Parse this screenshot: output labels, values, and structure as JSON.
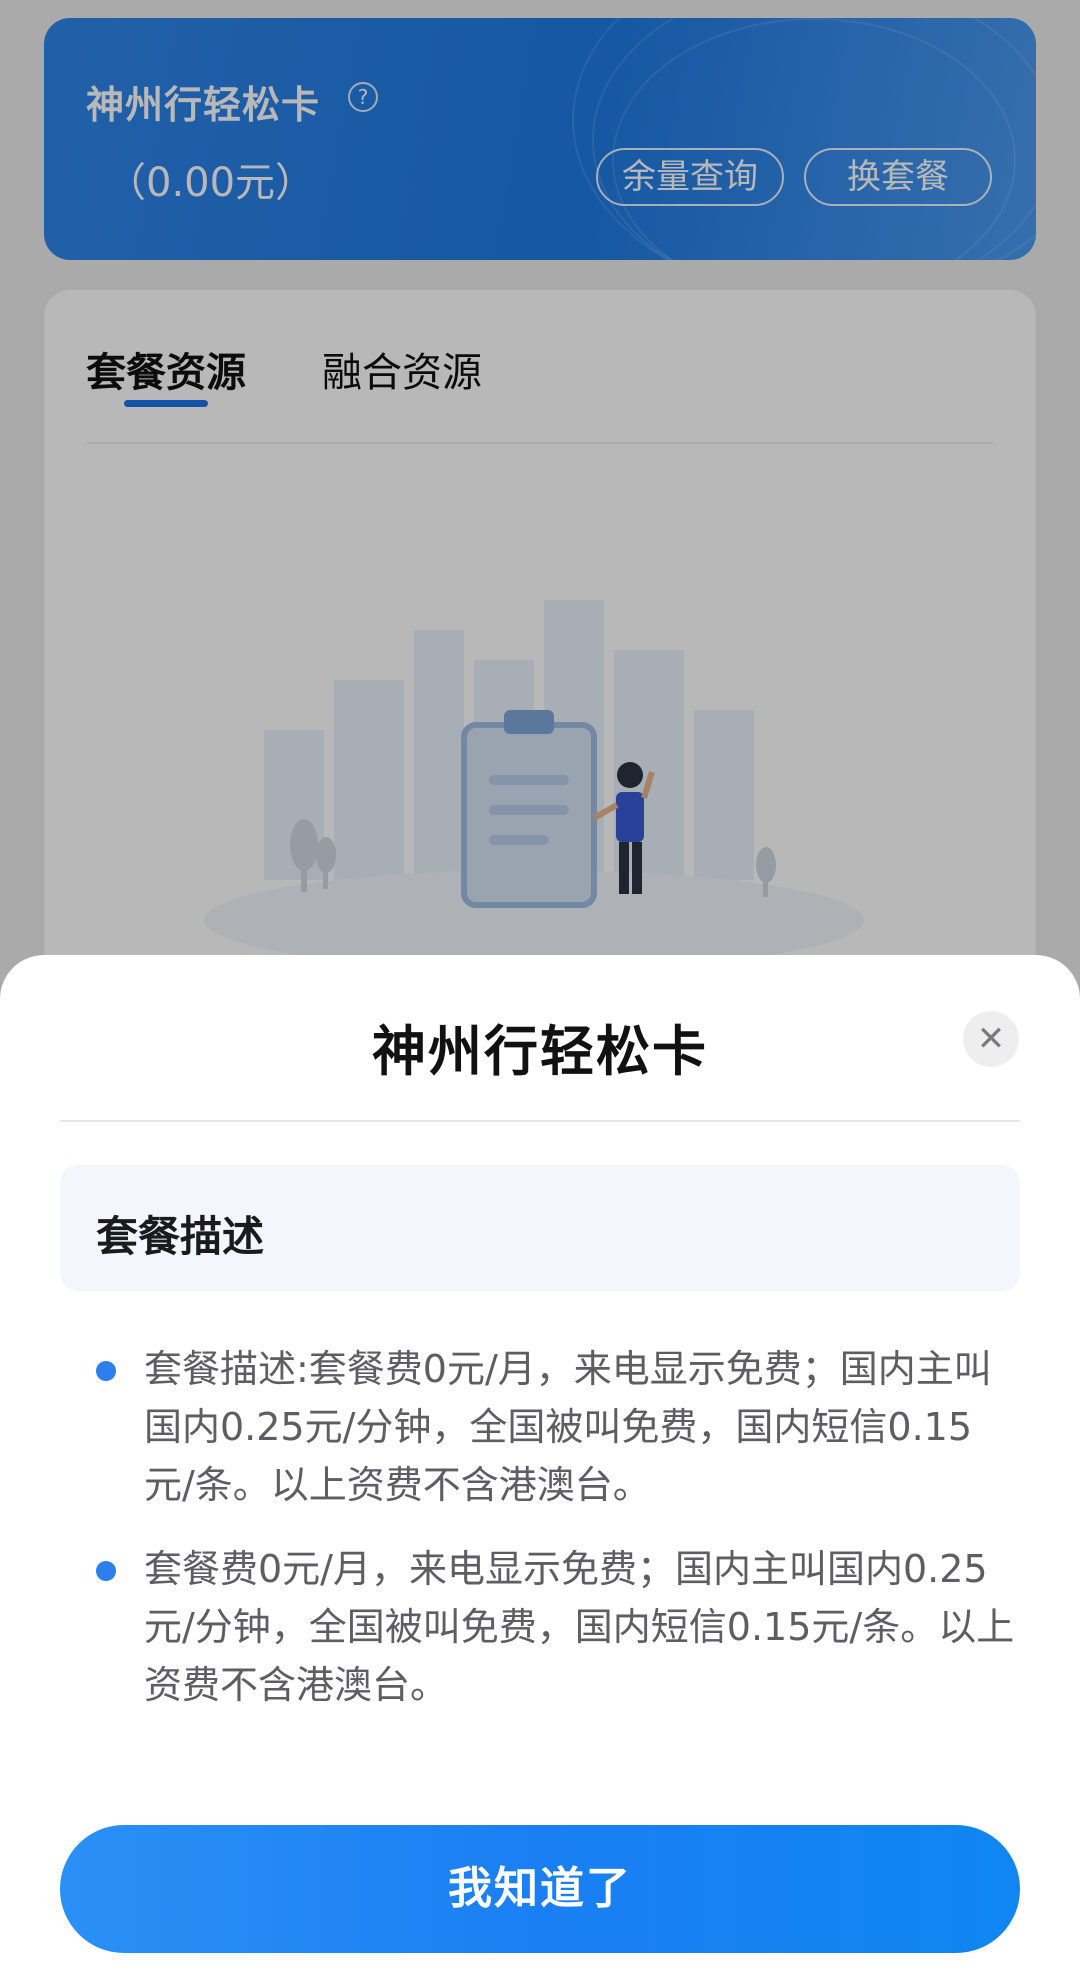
{
  "plan_card": {
    "name": "神州行轻松卡",
    "fee": "（0.00元）",
    "balance_button": "余量查询",
    "change_plan_button": "换套餐"
  },
  "resource_tabs": {
    "active_tab": "套餐资源",
    "other_tab": "融合资源"
  },
  "sheet": {
    "title": "神州行轻松卡",
    "section_header": "套餐描述",
    "items": [
      "套餐描述:套餐费0元/月，来电显示免费；国内主叫国内0.25元/分钟，全国被叫免费，国内短信0.15元/条。以上资费不含港澳台。",
      "套餐费0元/月，来电显示免费；国内主叫国内0.25元/分钟，全国被叫免费，国内短信0.15元/条。以上资费不含港澳台。"
    ],
    "confirm_button": "我知道了"
  },
  "icons": {
    "help": "help-circle-icon",
    "close": "close-icon"
  },
  "colors": {
    "primary": "#1a73e8",
    "card_blue": "#2f86ea",
    "bullet": "#2d7fee"
  }
}
